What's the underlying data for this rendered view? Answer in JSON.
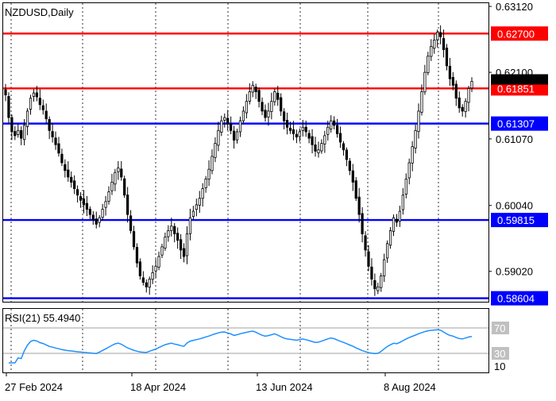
{
  "chart_data": [
    {
      "type": "candlestick",
      "title": "NZDUSD,Daily",
      "x_ticks": [
        "27 Feb 2024",
        "18 Apr 2024",
        "13 Jun 2024",
        "8 Aug 2024"
      ],
      "y_ticks": [
        "0.63120",
        "0.62100",
        "0.61070",
        "0.60040",
        "0.59020"
      ],
      "ylim": [
        0.5855,
        0.6317
      ],
      "levels": [
        {
          "label": "0.62700",
          "value": 0.627,
          "color": "#ff0000"
        },
        {
          "label": "0.61851",
          "value": 0.61851,
          "color": "#ff0000"
        },
        {
          "label": "0.61307",
          "value": 0.61307,
          "color": "#0000ff"
        },
        {
          "label": "0.59815",
          "value": 0.59815,
          "color": "#0000ff"
        },
        {
          "label": "0.58604",
          "value": 0.58604,
          "color": "#0000ff"
        }
      ],
      "current_price": 0.6196,
      "close_series": [
        0.6175,
        0.614,
        0.6118,
        0.6112,
        0.612,
        0.6108,
        0.6128,
        0.615,
        0.617,
        0.6178,
        0.6172,
        0.616,
        0.6152,
        0.6138,
        0.612,
        0.611,
        0.6098,
        0.6085,
        0.607,
        0.6058,
        0.6048,
        0.604,
        0.603,
        0.602,
        0.6012,
        0.6005,
        0.5998,
        0.599,
        0.5982,
        0.5975,
        0.5985,
        0.5998,
        0.601,
        0.6025,
        0.604,
        0.6055,
        0.6062,
        0.6048,
        0.602,
        0.599,
        0.5965,
        0.594,
        0.5915,
        0.5895,
        0.5885,
        0.5878,
        0.589,
        0.59,
        0.591,
        0.5925,
        0.594,
        0.5955,
        0.5965,
        0.5972,
        0.596,
        0.595,
        0.5935,
        0.5925,
        0.596,
        0.5985,
        0.5995,
        0.6005,
        0.6015,
        0.603,
        0.6045,
        0.606,
        0.608,
        0.61,
        0.612,
        0.6135,
        0.614,
        0.613,
        0.612,
        0.6105,
        0.6118,
        0.6135,
        0.615,
        0.6165,
        0.618,
        0.619,
        0.618,
        0.6165,
        0.615,
        0.614,
        0.615,
        0.6165,
        0.618,
        0.6168,
        0.615,
        0.6135,
        0.6125,
        0.612,
        0.6115,
        0.611,
        0.6118,
        0.6125,
        0.6118,
        0.6108,
        0.6098,
        0.6088,
        0.609,
        0.61,
        0.6112,
        0.6125,
        0.6135,
        0.6128,
        0.6115,
        0.6102,
        0.609,
        0.6075,
        0.6058,
        0.604,
        0.6015,
        0.599,
        0.596,
        0.5935,
        0.591,
        0.589,
        0.5875,
        0.5878,
        0.5895,
        0.592,
        0.5945,
        0.5965,
        0.5985,
        0.5978,
        0.5995,
        0.602,
        0.6045,
        0.607,
        0.6095,
        0.612,
        0.615,
        0.618,
        0.621,
        0.6235,
        0.625,
        0.626,
        0.6272,
        0.6265,
        0.6245,
        0.622,
        0.62,
        0.619,
        0.617,
        0.6155,
        0.615,
        0.6165,
        0.6185,
        0.6196
      ]
    },
    {
      "type": "line",
      "title": "RSI(21) 55.4940",
      "y_ticks": [
        "70",
        "30",
        "10"
      ],
      "ylim": [
        0,
        100
      ],
      "reference_lines": [
        70,
        30
      ],
      "series": [
        {
          "name": "RSI(21)"
        }
      ]
    }
  ]
}
